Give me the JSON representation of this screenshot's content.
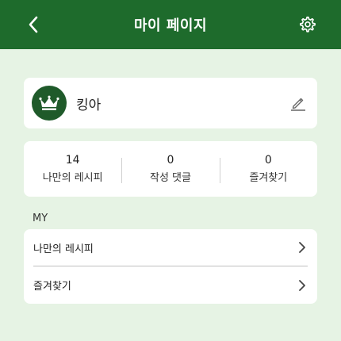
{
  "header": {
    "title": "마이 페이지",
    "back_icon": "chevron-left-icon",
    "settings_icon": "gear-icon"
  },
  "profile": {
    "avatar_icon": "crown-icon",
    "nickname": "킹아",
    "edit_icon": "pencil-icon"
  },
  "stats": [
    {
      "value": "14",
      "label": "나만의 레시피"
    },
    {
      "value": "0",
      "label": "작성 댓글"
    },
    {
      "value": "0",
      "label": "즐겨찾기"
    }
  ],
  "section": {
    "label": "MY"
  },
  "menu": [
    {
      "label": "나만의 레시피",
      "icon": "chevron-right-icon"
    },
    {
      "label": "즐겨찾기",
      "icon": "chevron-right-icon"
    }
  ],
  "colors": {
    "header_bg": "#1e6b2c",
    "page_bg": "#e6f3e4",
    "avatar_bg": "#1f5a2a",
    "card_bg": "#ffffff"
  }
}
